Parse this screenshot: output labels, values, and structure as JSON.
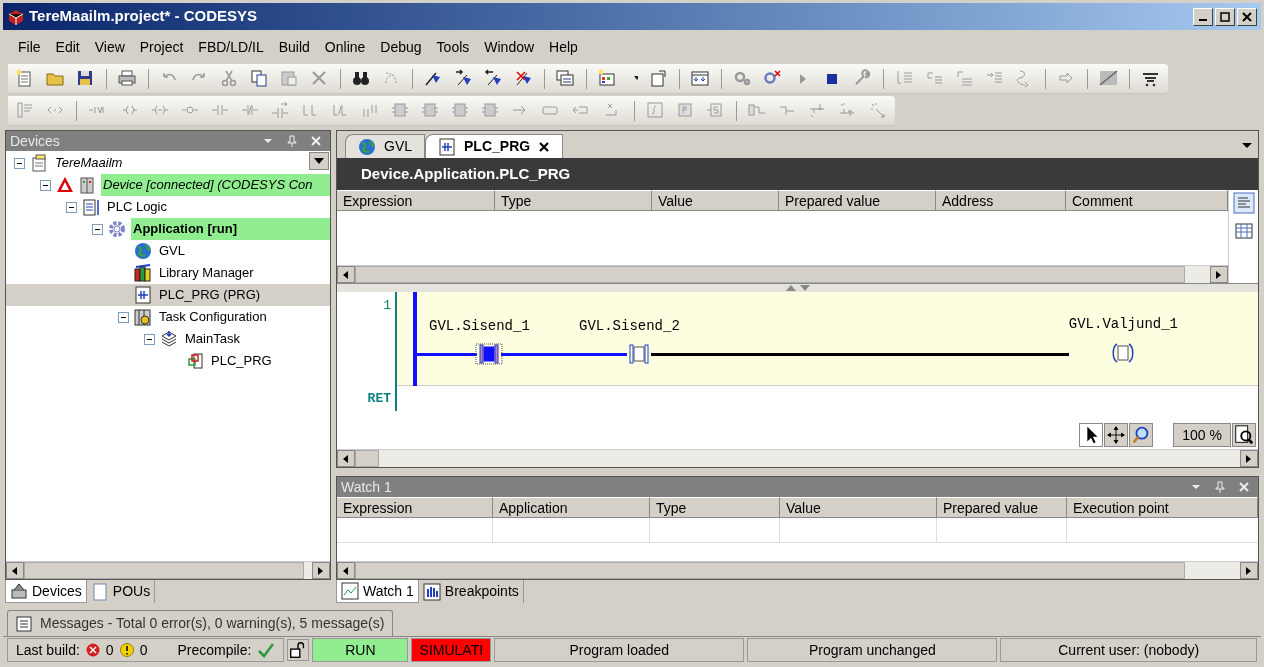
{
  "window": {
    "title": "TereMaailm.project* - CODESYS"
  },
  "menu": [
    "File",
    "Edit",
    "View",
    "Project",
    "FBD/LD/IL",
    "Build",
    "Online",
    "Debug",
    "Tools",
    "Window",
    "Help"
  ],
  "devices_panel": {
    "title": "Devices",
    "tree": [
      {
        "label": "TereMaailm",
        "kind": "project",
        "online": false,
        "selected": false,
        "expanded": true,
        "children": [
          {
            "label": "Device [connected] (CODESYS Con",
            "kind": "device",
            "online": true,
            "selected": false,
            "expanded": true,
            "children": [
              {
                "label": "PLC Logic",
                "kind": "plc-logic",
                "online": false,
                "selected": false,
                "expanded": true,
                "children": [
                  {
                    "label": "Application [run]",
                    "kind": "application",
                    "online": true,
                    "selected": false,
                    "expanded": true,
                    "children": [
                      {
                        "label": "GVL",
                        "kind": "gvl",
                        "online": false,
                        "selected": false
                      },
                      {
                        "label": "Library Manager",
                        "kind": "library",
                        "online": false,
                        "selected": false
                      },
                      {
                        "label": "PLC_PRG (PRG)",
                        "kind": "pou",
                        "online": false,
                        "selected": true
                      },
                      {
                        "label": "Task Configuration",
                        "kind": "task-config",
                        "online": false,
                        "selected": false,
                        "expanded": true,
                        "children": [
                          {
                            "label": "MainTask",
                            "kind": "task",
                            "online": false,
                            "selected": false,
                            "expanded": true,
                            "children": [
                              {
                                "label": "PLC_PRG",
                                "kind": "task-call",
                                "online": false,
                                "selected": false
                              }
                            ]
                          }
                        ]
                      }
                    ]
                  }
                ]
              }
            ]
          }
        ]
      }
    ]
  },
  "left_tabs": [
    {
      "label": "Devices",
      "kind": "devices",
      "selected": true
    },
    {
      "label": "POUs",
      "kind": "pous",
      "selected": false
    }
  ],
  "editor": {
    "tabs": [
      {
        "label": "GVL",
        "kind": "gvl",
        "selected": false
      },
      {
        "label": "PLC_PRG",
        "kind": "pou",
        "selected": true
      }
    ],
    "path": "Device.Application.PLC_PRG",
    "columns": [
      "Expression",
      "Type",
      "Value",
      "Prepared value",
      "Address",
      "Comment"
    ],
    "network": {
      "number": "1",
      "contacts": [
        {
          "label": "GVL.Sisend_1",
          "on": true
        },
        {
          "label": "GVL.Sisend_2",
          "on": false
        }
      ],
      "coil": {
        "label": "GVL.Valjund_1",
        "on": false
      }
    },
    "ret": "RET",
    "zoom": "100 %"
  },
  "watch": {
    "title": "Watch 1",
    "columns": [
      "Expression",
      "Application",
      "Type",
      "Value",
      "Prepared value",
      "Execution point"
    ]
  },
  "bottom_tabs": [
    {
      "label": "Watch 1",
      "kind": "watch",
      "selected": true
    },
    {
      "label": "Breakpoints",
      "kind": "breakpoints",
      "selected": false
    }
  ],
  "messages": "Messages - Total 0 error(s), 0 warning(s), 5 message(s)",
  "status_bar": {
    "last_build": "Last build:",
    "errors": "0",
    "warnings": "0",
    "precompile": "Precompile:",
    "precompile_ok": true,
    "locked": false,
    "state": "RUN",
    "simulation": "SIMULATI",
    "program": "Program loaded",
    "changes": "Program unchanged",
    "user": "Current user: (nobody)"
  }
}
